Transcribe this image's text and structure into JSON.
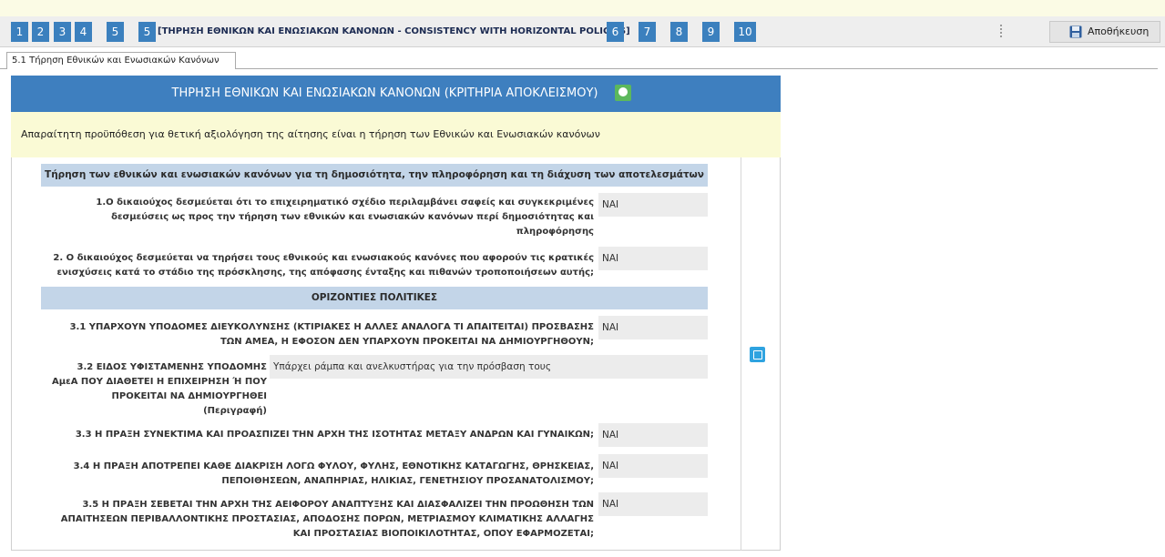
{
  "nav": {
    "steps": [
      "1",
      "2",
      "3",
      "4",
      "5",
      "6",
      "7",
      "8",
      "9",
      "10"
    ],
    "current_label": "[ΤΗΡΗΣΗ ΕΘΝΙΚΩΝ ΚΑΙ ΕΝΩΣΙΑΚΩΝ ΚΑΝΟΝΩΝ - CONSISTENCY WITH HORIZONTAL POLICIES]",
    "save_label": "Αποθήκευση",
    "save_icon": "floppy-disk-icon",
    "more_icon": "vertical-dots-icon"
  },
  "tab": {
    "label": "5.1 Τήρηση Εθνικών και Ενωσιακών Κανόνων"
  },
  "panel": {
    "title": "ΤΗΡΗΣΗ ΕΘΝΙΚΩΝ ΚΑΙ ΕΝΩΣΙΑΚΩΝ ΚΑΝΟΝΩΝ (ΚΡΙΤΗΡΙΑ ΑΠΟΚΛΕΙΣΜΟΥ)",
    "help_icon": "info-icon",
    "notice": "Απαραίτητη προϋπόθεση για θετική αξιολόγηση της αίτησης είναι η τήρηση των Εθνικών και Ενωσιακών κανόνων",
    "edit_icon": "edit-icon"
  },
  "sections": [
    {
      "title": "Τήρηση των εθνικών και ενωσιακών κανόνων για τη δημοσιότητα, την πληροφόρηση και τη διάχυση των αποτελεσμάτων",
      "items": [
        {
          "lines": [
            "1.Ο δικαιούχος δεσμεύεται ότι το επιχειρηματικό σχέδιο περιλαμβάνει σαφείς και συγκεκριμένες",
            "δεσμεύσεις ως προς την τήρηση των εθνικών και ενωσιακών κανόνων περί δημοσιότητας και",
            "πληροφόρησης"
          ],
          "answer": "ΝΑΙ"
        },
        {
          "lines": [
            "2. Ο δικαιούχος δεσμεύεται να τηρήσει τους εθνικούς και ενωσιακούς κανόνες που αφορούν τις κρατικές",
            "ενισχύσεις κατά το στάδιο της πρόσκλησης, της απόφασης ένταξης και πιθανών τροποποιήσεων αυτής;"
          ],
          "answer": "ΝΑΙ"
        }
      ]
    },
    {
      "title": "ΟΡΙΖΟΝΤΙΕΣ ΠΟΛΙΤΙΚΕΣ",
      "items": [
        {
          "lines": [
            "3.1 ΥΠΑΡΧΟΥΝ ΥΠΟΔΟΜΕΣ ΔΙΕΥΚΟΛΥΝΣΗΣ (ΚΤΙΡΙΑΚΕΣ Η ΑΛΛΕΣ ΑΝΑΛΟΓΑ ΤΙ ΑΠΑΙΤΕΙΤΑΙ) ΠΡΟΣΒΑΣΗΣ",
            "ΤΩΝ ΑΜΕΑ, Η ΕΦΟΣΟΝ ΔΕΝ ΥΠΑΡΧΟΥΝ ΠΡΟΚΕΙΤΑΙ ΝΑ ΔΗΜΙΟΥΡΓΗΘΟΥΝ;"
          ],
          "answer": "ΝΑΙ"
        },
        {
          "lines": [
            "3.2 ΕΙΔΟΣ ΥΦΙΣΤΑΜΕΝΗΣ ΥΠΟΔΟΜΗΣ",
            "ΑμεΑ ΠΟΥ ΔΙΑΘΕΤΕΙ Η ΕΠΙΧΕΙΡΗΣΗ Ή ΠΟΥ",
            "ΠΡΟΚΕΙΤΑΙ ΝΑ ΔΗΜΙΟΥΡΓΗΘΕΙ",
            "(Περιγραφή)"
          ],
          "answer": "Υπάρχει ράμπα και ανελκυστήρας για την πρόσβαση τους"
        },
        {
          "lines": [
            "3.3 Η ΠΡΑΞΗ ΣΥΝΕΚΤΙΜΑ ΚΑΙ ΠΡΟΑΣΠΙΖΕΙ ΤΗΝ ΑΡΧΗ ΤΗΣ ΙΣΟΤΗΤΑΣ ΜΕΤΑΞΥ ΑΝΔΡΩΝ ΚΑΙ ΓΥΝΑΙΚΩΝ;"
          ],
          "answer": "ΝΑΙ"
        },
        {
          "lines": [
            "3.4 Η ΠΡΑΞΗ ΑΠΟΤΡΕΠΕΙ ΚΑΘΕ ΔΙΑΚΡΙΣΗ ΛΟΓΩ ΦΥΛΟΥ, ΦΥΛΗΣ, ΕΘΝΟΤΙΚΗΣ ΚΑΤΑΓΩΓΗΣ, ΘΡΗΣΚΕΙΑΣ,",
            "ΠΕΠΟΙΘΗΣΕΩΝ, ΑΝΑΠΗΡΙΑΣ, ΗΛΙΚΙΑΣ, ΓΕΝΕΤΗΣΙΟΥ ΠΡΟΣΑΝΑΤΟΛΙΣΜΟΥ;"
          ],
          "answer": "ΝΑΙ"
        },
        {
          "lines": [
            "3.5 Η ΠΡΑΞΗ ΣΕΒΕΤΑΙ ΤΗΝ ΑΡΧΗ ΤΗΣ ΑΕΙΦΟΡΟΥ ΑΝΑΠΤΥΞΗΣ ΚΑΙ ΔΙΑΣΦΑΛΙΖΕΙ ΤΗΝ ΠΡΟΩΘΗΣΗ ΤΩΝ",
            "ΑΠΑΙΤΗΣΕΩΝ ΠΕΡΙΒΑΛΛΟΝΤΙΚΗΣ ΠΡΟΣΤΑΣΙΑΣ, ΑΠΟΔΟΣΗΣ ΠΟΡΩΝ, ΜΕΤΡΙΑΣΜΟΥ ΚΛΙΜΑΤΙΚΗΣ ΑΛΛΑΓΗΣ",
            "ΚΑΙ ΠΡΟΣΤΑΣΙΑΣ ΒΙΟΠΟΙΚΙΛΟΤΗΤΑΣ, ΟΠΟΥ ΕΦΑΡΜΟΖΕΤΑΙ;"
          ],
          "answer": "ΝΑΙ"
        }
      ]
    }
  ],
  "colors": {
    "step_bg": "#3b80be",
    "panel_header": "#3e7fbf",
    "notice_bg": "#fafad5",
    "section_head": "#c3d5e8",
    "answer_bg": "#ececec",
    "help_green": "#5cb85c",
    "edit_blue": "#2fa3e0"
  }
}
